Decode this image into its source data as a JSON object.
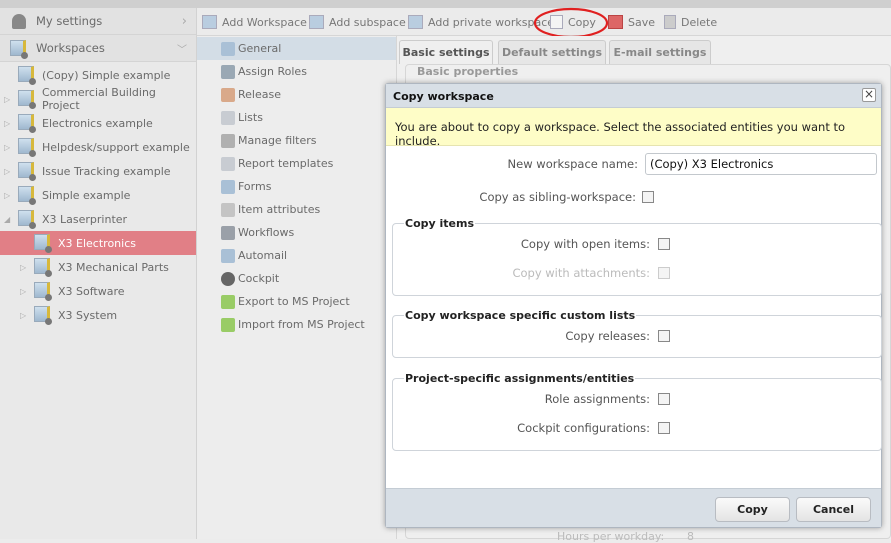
{
  "sidebar": {
    "my_settings": "My settings",
    "workspaces": "Workspaces",
    "items": [
      "(Copy) Simple example",
      "Commercial Building Project",
      "Electronics example",
      "Helpdesk/support example",
      "Issue Tracking example",
      "Simple example",
      "X3 Laserprinter",
      "X3 Electronics",
      "X3 Mechanical Parts",
      "X3 Software",
      "X3 System"
    ],
    "selected": "X3 Electronics"
  },
  "toolbar": {
    "add_workspace": "Add Workspace",
    "add_subspace": "Add subspace",
    "add_private": "Add private workspace",
    "copy": "Copy",
    "save": "Save",
    "delete": "Delete",
    "highlight_color": "#e02020"
  },
  "nav": {
    "items": [
      "General",
      "Assign Roles",
      "Release",
      "Lists",
      "Manage filters",
      "Report templates",
      "Forms",
      "Item attributes",
      "Workflows",
      "Automail",
      "Cockpit",
      "Export to MS Project",
      "Import from MS Project"
    ]
  },
  "tabs": [
    "Basic settings",
    "Default settings",
    "E-mail settings"
  ],
  "content": {
    "section": "Basic properties",
    "hours_label": "Hours per workday:",
    "hours_value": "8"
  },
  "dialog": {
    "title": "Copy workspace",
    "note": "You are about to copy a workspace. Select the associated entities you want to include.",
    "name_label": "New workspace name:",
    "name_value": "(Copy) X3 Electronics",
    "sibling_label": "Copy as sibling-workspace:",
    "items_legend": "Copy items",
    "open_items": "Copy with open items:",
    "attachments": "Copy with attachments:",
    "lists_legend": "Copy workspace specific custom lists",
    "releases": "Copy releases:",
    "assign_legend": "Project-specific assignments/entities",
    "roles": "Role assignments:",
    "cockpit": "Cockpit configurations:",
    "copy_button": "Copy",
    "cancel_button": "Cancel"
  }
}
